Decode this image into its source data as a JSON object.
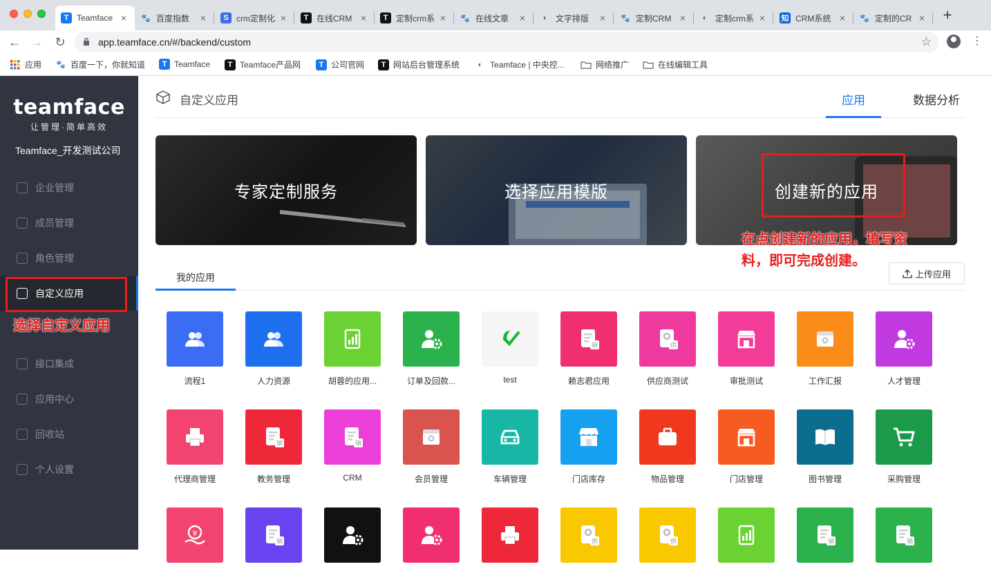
{
  "browser": {
    "tabs": [
      {
        "title": "Teamface",
        "favicon_text": "T",
        "color": "#1877f2"
      },
      {
        "title": "百度指数",
        "favicon_text": "🐾",
        "color": "#2b5bd7"
      },
      {
        "title": "crm定制化",
        "favicon_text": "S",
        "color": "#3b6fe0"
      },
      {
        "title": "在线CRM",
        "favicon_text": "T",
        "color": "#111111"
      },
      {
        "title": "定制crm系",
        "favicon_text": "T",
        "color": "#111111"
      },
      {
        "title": "在线文章",
        "favicon_text": "🐾",
        "color": "#2b5bd7"
      },
      {
        "title": "文字排版",
        "favicon_text": "◐",
        "color": "#5f6368"
      },
      {
        "title": "定制CRM",
        "favicon_text": "🐾",
        "color": "#2b5bd7"
      },
      {
        "title": "定制crm系",
        "favicon_text": "◐",
        "color": "#5f6368"
      },
      {
        "title": "CRM系统",
        "favicon_text": "知",
        "color": "#0a66d8"
      },
      {
        "title": "定制的CR",
        "favicon_text": "🐾",
        "color": "#2b5bd7"
      }
    ],
    "url": "app.teamface.cn/#/backend/custom",
    "bookmarks": [
      {
        "label": "应用",
        "icon": "apps-grid-icon"
      },
      {
        "label": "百度一下，你就知道",
        "icon": "baidu-icon"
      },
      {
        "label": "Teamface",
        "icon": "teamface-icon"
      },
      {
        "label": "Teamface产品网",
        "icon": "teamface-black-icon"
      },
      {
        "label": "公司官网",
        "icon": "teamface-icon"
      },
      {
        "label": "网站后台管理系统",
        "icon": "teamface-black-icon"
      },
      {
        "label": "Teamface | 中央控...",
        "icon": "globe-icon"
      },
      {
        "label": "网络推广",
        "icon": "folder-icon"
      },
      {
        "label": "在线编辑工具",
        "icon": "folder-icon"
      }
    ]
  },
  "sidebar": {
    "brand": "teamface",
    "slogan": "让管理·简单高效",
    "company": "Teamface_开发测试公司",
    "items": [
      {
        "label": "企业管理"
      },
      {
        "label": "成员管理"
      },
      {
        "label": "角色管理"
      },
      {
        "label": "自定义应用",
        "active": true
      },
      {
        "label": "接口集成"
      },
      {
        "label": "应用中心"
      },
      {
        "label": "回收站"
      },
      {
        "label": "个人设置"
      }
    ],
    "annotation": "选择自定义应用"
  },
  "header": {
    "title": "自定义应用",
    "tabs": [
      {
        "label": "应用",
        "active": true
      },
      {
        "label": "数据分析"
      }
    ]
  },
  "banners": [
    {
      "label": "专家定制服务"
    },
    {
      "label": "选择应用模版"
    },
    {
      "label": "创建新的应用"
    }
  ],
  "banner_annotation": {
    "line1": "在点创建新的应用，填写资",
    "line2": "料，即可完成创建。"
  },
  "my_apps": {
    "tab": "我的应用",
    "upload_label": "上传应用"
  },
  "apps": [
    {
      "name": "流程1",
      "color": "#3a6cf4",
      "icon": "users-icon"
    },
    {
      "name": "人力资源",
      "color": "#1e6ff0",
      "icon": "users-icon"
    },
    {
      "name": "胡蓉的应用...",
      "color": "#6ad232",
      "icon": "chart-doc-icon"
    },
    {
      "name": "订单及回款...",
      "color": "#2bb24c",
      "icon": "user-gear-icon"
    },
    {
      "name": "test",
      "color": "#f5f5f5",
      "icon": "wechat-pay-icon"
    },
    {
      "name": "赖志君应用",
      "color": "#f0306e",
      "icon": "sales-doc-icon"
    },
    {
      "name": "供应商测试",
      "color": "#ee3a9e",
      "icon": "supply-doc-icon"
    },
    {
      "name": "审批测试",
      "color": "#f33b9a",
      "icon": "shop-icon"
    },
    {
      "name": "工作汇报",
      "color": "#fb8c1a",
      "icon": "box-icon"
    },
    {
      "name": "人才管理",
      "color": "#c13ae0",
      "icon": "user-gear-icon"
    },
    {
      "name": "代理商管理",
      "color": "#f2446f",
      "icon": "printer-icon"
    },
    {
      "name": "教务管理",
      "color": "#ee2739",
      "icon": "sales-doc-icon"
    },
    {
      "name": "CRM",
      "color": "#ec3ed8",
      "icon": "sales-doc-icon"
    },
    {
      "name": "会员管理",
      "color": "#d9534f",
      "icon": "box-icon"
    },
    {
      "name": "车辆管理",
      "color": "#18b6a4",
      "icon": "car-icon"
    },
    {
      "name": "门店库存",
      "color": "#16a1f0",
      "icon": "store-icon"
    },
    {
      "name": "物品管理",
      "color": "#f0381e",
      "icon": "briefcase-icon"
    },
    {
      "name": "门店管理",
      "color": "#f65b21",
      "icon": "shop-icon"
    },
    {
      "name": "图书管理",
      "color": "#0c6e8f",
      "icon": "book-icon"
    },
    {
      "name": "采购管理",
      "color": "#1c9a4a",
      "icon": "cart-icon"
    },
    {
      "name": "",
      "color": "#f2446f",
      "icon": "money-hand-icon"
    },
    {
      "name": "",
      "color": "#6a43f0",
      "icon": "sales-doc-icon"
    },
    {
      "name": "",
      "color": "#111111",
      "icon": "user-gear-icon"
    },
    {
      "name": "",
      "color": "#f0306e",
      "icon": "user-gear-icon"
    },
    {
      "name": "",
      "color": "#ee2739",
      "icon": "printer-icon"
    },
    {
      "name": "",
      "color": "#f9c800",
      "icon": "supply-doc-icon"
    },
    {
      "name": "",
      "color": "#f9c800",
      "icon": "supply-doc-icon"
    },
    {
      "name": "",
      "color": "#6ad232",
      "icon": "chart-doc-icon"
    },
    {
      "name": "",
      "color": "#2bb24c",
      "icon": "sales-doc-icon"
    },
    {
      "name": "",
      "color": "#2bb24c",
      "icon": "sales-doc-icon"
    }
  ]
}
